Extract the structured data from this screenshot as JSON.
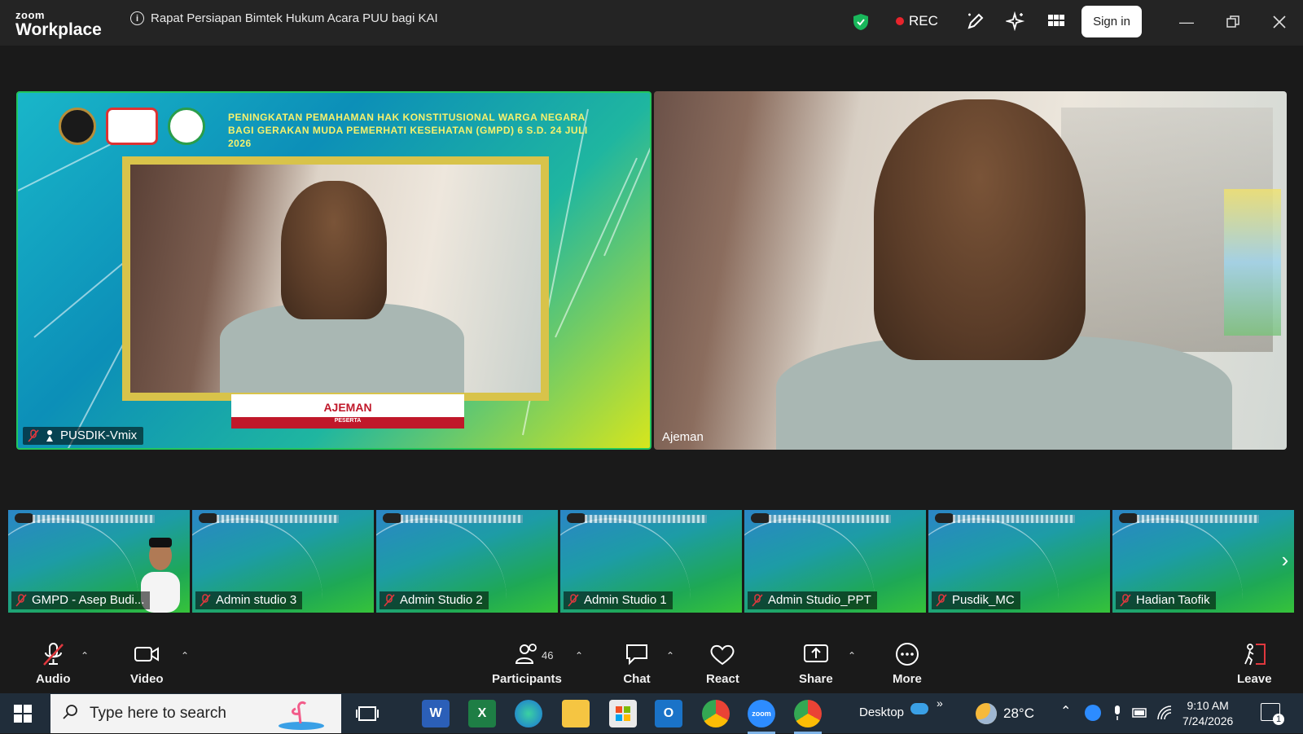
{
  "titlebar": {
    "brand_top": "zoom",
    "brand_bottom": "Workplace",
    "meeting_title": "Rapat Persiapan Bimtek Hukum Acara PUU bagi KAI",
    "rec_label": "REC",
    "sign_in": "Sign in"
  },
  "main": {
    "left_tile": {
      "participant_name": "PUSDIK-Vmix",
      "banner_text": "PENINGKATAN PEMAHAMAN HAK KONSTITUSIONAL WARGA NEGARA BAGI GERAKAN MUDA PEMERHATI KESEHATAN (GMPD) 6 S.D. 24 JULI 2026",
      "card_name": "AJEMAN",
      "card_role": "PESERTA"
    },
    "right_tile": {
      "participant_name": "Ajeman"
    }
  },
  "thumbnails": [
    {
      "name": "GMPD - Asep Budi..."
    },
    {
      "name": "Admin studio 3"
    },
    {
      "name": "Admin Studio 2"
    },
    {
      "name": "Admin Studio 1"
    },
    {
      "name": "Admin Studio_PPT"
    },
    {
      "name": "Pusdik_MC"
    },
    {
      "name": "Hadian Taofik"
    }
  ],
  "toolbar": {
    "audio": "Audio",
    "video": "Video",
    "participants": "Participants",
    "participant_count": "46",
    "chat": "Chat",
    "react": "React",
    "share": "Share",
    "more": "More",
    "leave": "Leave"
  },
  "taskbar": {
    "search_placeholder": "Type here to search",
    "desktop_label": "Desktop",
    "temperature": "28°C",
    "time": "9:10 AM",
    "date": "7/24/2026",
    "notification_count": "1"
  },
  "colors": {
    "active_speaker_border": "#22c55e",
    "rec_dot": "#e8242c",
    "muted_icon": "#e0383e",
    "shield": "#19b75b"
  }
}
